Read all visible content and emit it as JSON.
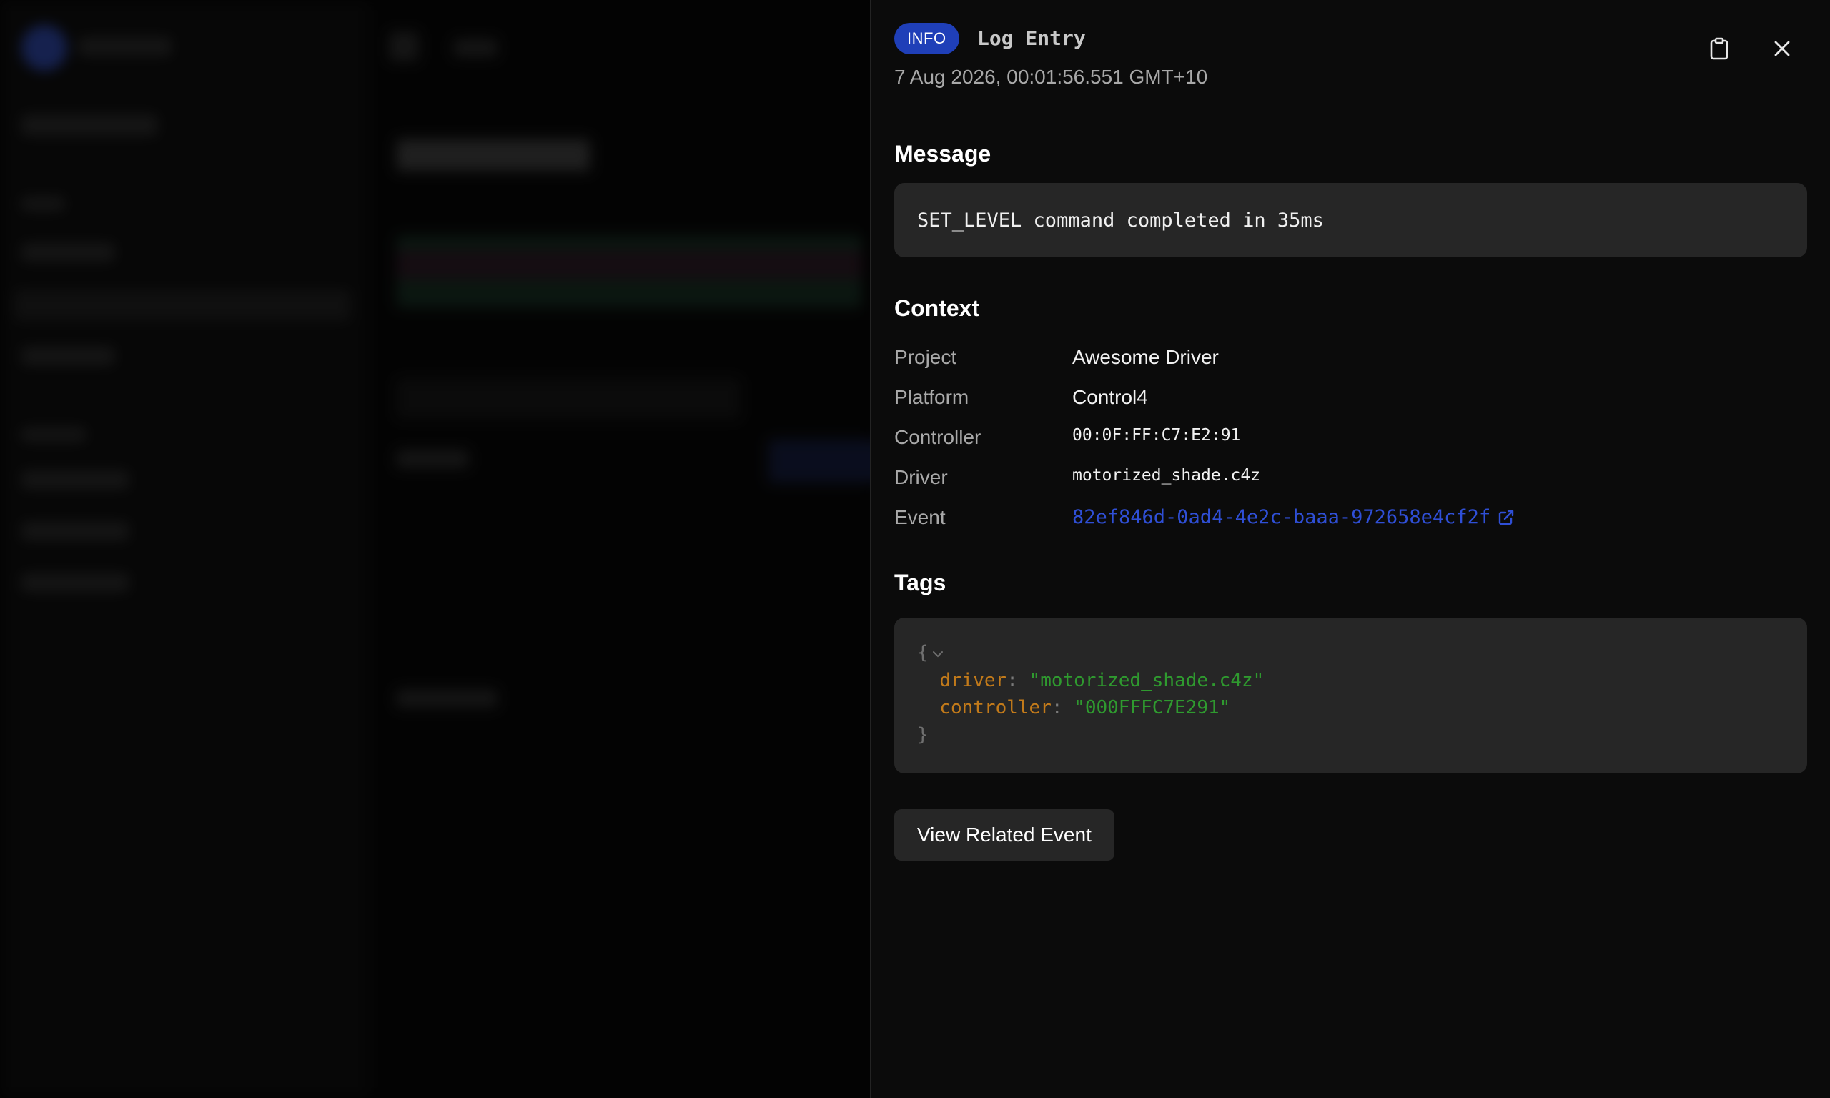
{
  "background": {
    "note_visible": false
  },
  "drawer": {
    "level_badge": "INFO",
    "title": "Log Entry",
    "timestamp": "7 Aug 2026, 00:01:56.551 GMT+10",
    "icons": {
      "copy": "clipboard-icon",
      "close": "close-icon"
    },
    "message_heading": "Message",
    "message": "SET_LEVEL command completed in 35ms",
    "context_heading": "Context",
    "context": {
      "project_label": "Project",
      "project_value": "Awesome Driver",
      "platform_label": "Platform",
      "platform_value": "Control4",
      "controller_label": "Controller",
      "controller_value": "00:0F:FF:C7:E2:91",
      "driver_label": "Driver",
      "driver_value": "motorized_shade.c4z",
      "event_label": "Event",
      "event_value": "82ef846d-0ad4-4e2c-baaa-972658e4cf2f"
    },
    "tags_heading": "Tags",
    "tags": {
      "open_brace": "{",
      "close_brace": "}",
      "driver_key": "driver",
      "driver_value": "\"motorized_shade.c4z\"",
      "controller_key": "controller",
      "controller_value": "\"000FFFC7E291\""
    },
    "related_button": "View Related Event"
  },
  "colors": {
    "badge": "#1f3fb8",
    "link": "#2f4fd6",
    "json_key": "#c27a1a",
    "json_string": "#2f9a2f"
  }
}
